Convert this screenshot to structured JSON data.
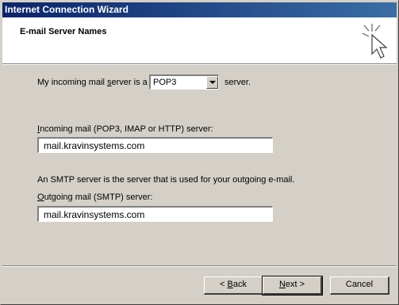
{
  "window": {
    "title": "Internet Connection Wizard"
  },
  "header": {
    "heading": "E-mail Server Names",
    "icon": "wizard-cursor-icon"
  },
  "incoming_server_type": {
    "label_prefix": "My incoming mail ",
    "label_accel": "s",
    "label_suffix": "erver is a",
    "selected": "POP3",
    "after_label": "server."
  },
  "incoming_server": {
    "label_accel": "I",
    "label_rest": "ncoming mail (POP3, IMAP or HTTP) server:",
    "value": "mail.kravinsystems.com"
  },
  "smtp_note": "An SMTP server is the server that is used for your outgoing e-mail.",
  "outgoing_server": {
    "label_accel": "O",
    "label_rest": "utgoing mail (SMTP) server:",
    "value": "mail.kravinsystems.com"
  },
  "buttons": {
    "back_prefix": "< ",
    "back_accel": "B",
    "back_rest": "ack",
    "next_accel": "N",
    "next_rest": "ext >",
    "cancel": "Cancel"
  }
}
